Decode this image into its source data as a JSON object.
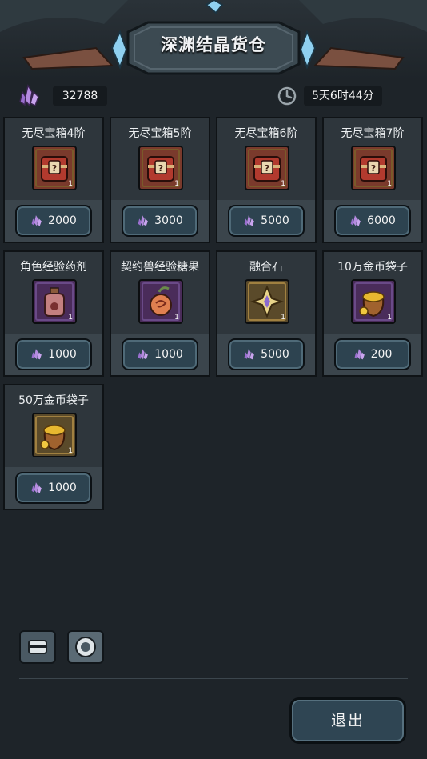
{
  "header": {
    "title": "深渊结晶货仓"
  },
  "currency": {
    "amount": "32788",
    "icon": "crystal-icon"
  },
  "timer": {
    "remaining": "5天6时44分",
    "icon": "clock-icon"
  },
  "items": [
    {
      "name": "无尽宝箱4阶",
      "qty": "1",
      "price": "2000",
      "icon": "chest-icon"
    },
    {
      "name": "无尽宝箱5阶",
      "qty": "1",
      "price": "3000",
      "icon": "chest-icon"
    },
    {
      "name": "无尽宝箱6阶",
      "qty": "1",
      "price": "5000",
      "icon": "chest-icon"
    },
    {
      "name": "无尽宝箱7阶",
      "qty": "1",
      "price": "6000",
      "icon": "chest-icon"
    },
    {
      "name": "角色经验药剂",
      "qty": "1",
      "price": "1000",
      "icon": "potion-icon"
    },
    {
      "name": "契约兽经验糖果",
      "qty": "1",
      "price": "1000",
      "icon": "candy-icon"
    },
    {
      "name": "融合石",
      "qty": "1",
      "price": "5000",
      "icon": "fusion-stone-icon"
    },
    {
      "name": "10万金币袋子",
      "qty": "1",
      "price": "200",
      "icon": "coin-bag-icon"
    },
    {
      "name": "50万金币袋子",
      "qty": "1",
      "price": "1000",
      "icon": "coin-bag-icon"
    }
  ],
  "tabs": [
    {
      "icon": "chest-tab-icon"
    },
    {
      "icon": "emblem-tab-icon"
    }
  ],
  "footer": {
    "exit_label": "退出"
  },
  "colors": {
    "background": "#1e2429",
    "card": "#2e363c",
    "price_button": "#2d4350",
    "crystal": "#b58be0"
  }
}
